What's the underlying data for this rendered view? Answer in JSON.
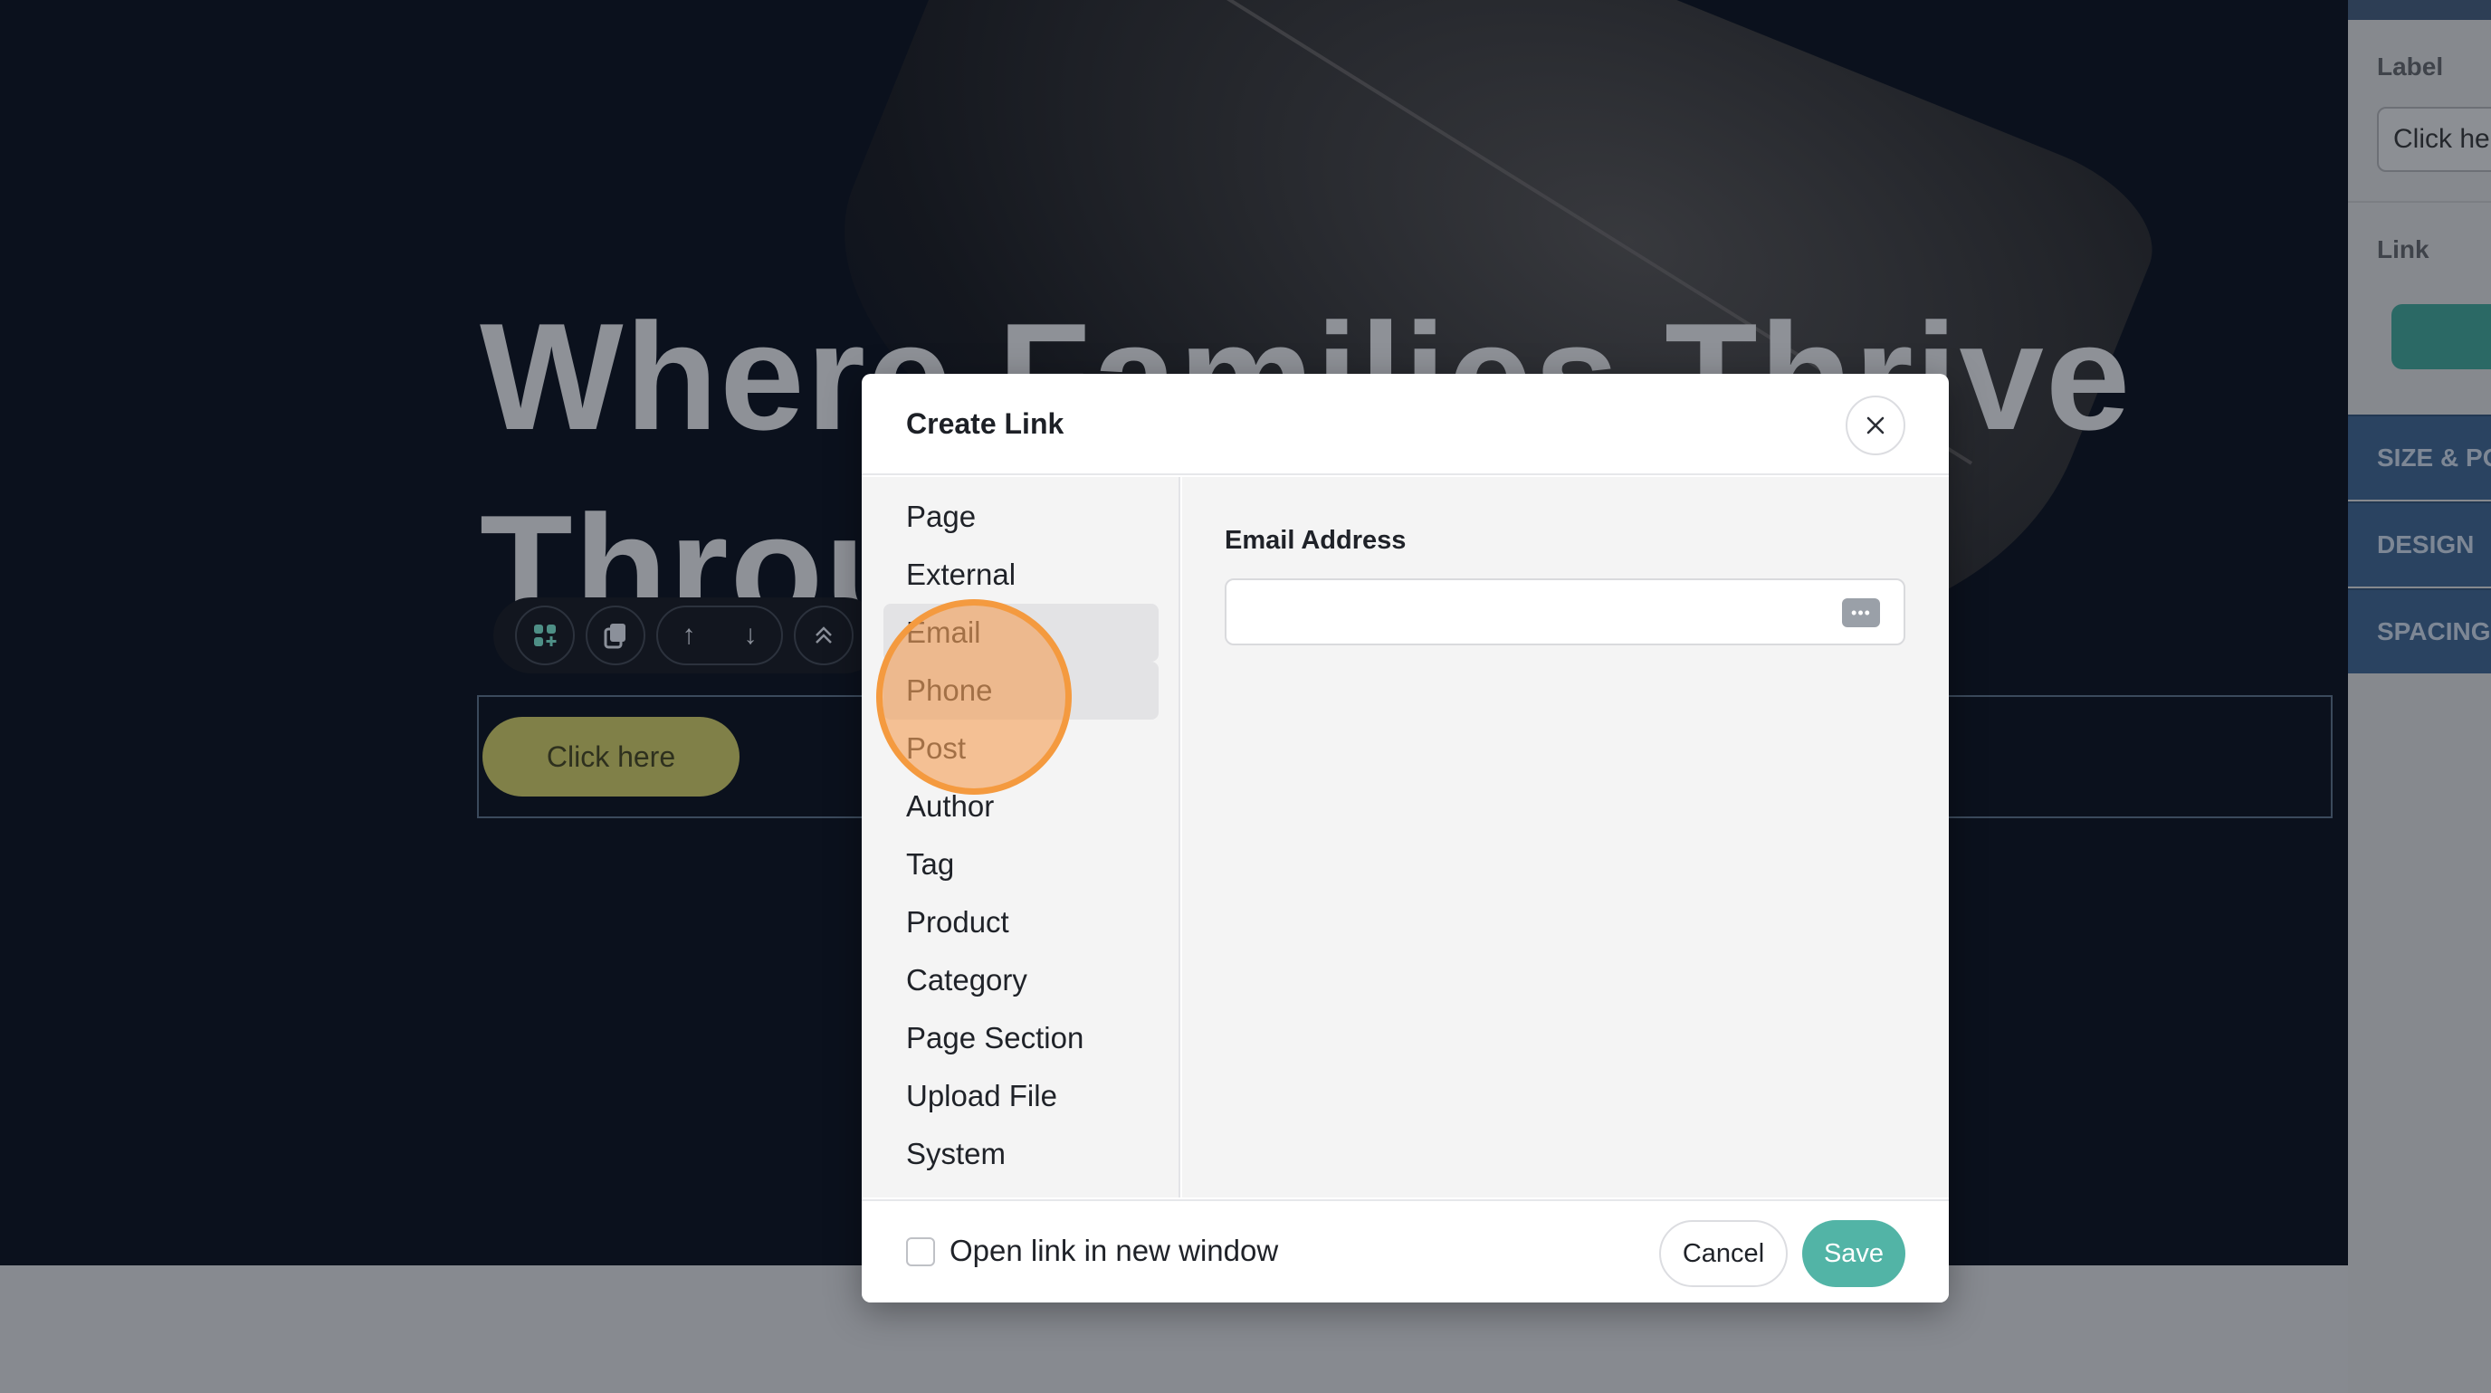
{
  "hero": {
    "title_line1": "Where Families Thrive",
    "title_line2": "Through",
    "cta_label": "Click here"
  },
  "element_toolbar": {
    "icons": [
      "add-block-icon",
      "duplicate-icon",
      "arrow-up-icon",
      "arrow-down-icon",
      "move-to-top-icon"
    ]
  },
  "sidebar": {
    "label_heading": "Label",
    "label_value": "Click here",
    "link_heading": "Link",
    "sections": [
      "SIZE & POSITION",
      "DESIGN",
      "SPACING"
    ]
  },
  "modal": {
    "title": "Create Link",
    "nav_items": [
      {
        "label": "Page"
      },
      {
        "label": "External"
      },
      {
        "label": "Email"
      },
      {
        "label": "Phone"
      },
      {
        "label": "Post"
      },
      {
        "label": "Author"
      },
      {
        "label": "Tag"
      },
      {
        "label": "Product"
      },
      {
        "label": "Category"
      },
      {
        "label": "Page Section"
      },
      {
        "label": "Upload File"
      },
      {
        "label": "System"
      }
    ],
    "active_nav": "Email",
    "email_label": "Email Address",
    "email_value": "",
    "new_window_label": "Open link in new window",
    "new_window_checked": false,
    "cancel_label": "Cancel",
    "save_label": "Save"
  },
  "colors": {
    "accent": "#52b4a6",
    "hero_bg": "#0b111d",
    "cta": "#808048",
    "click_marker": "#f49a3f"
  }
}
